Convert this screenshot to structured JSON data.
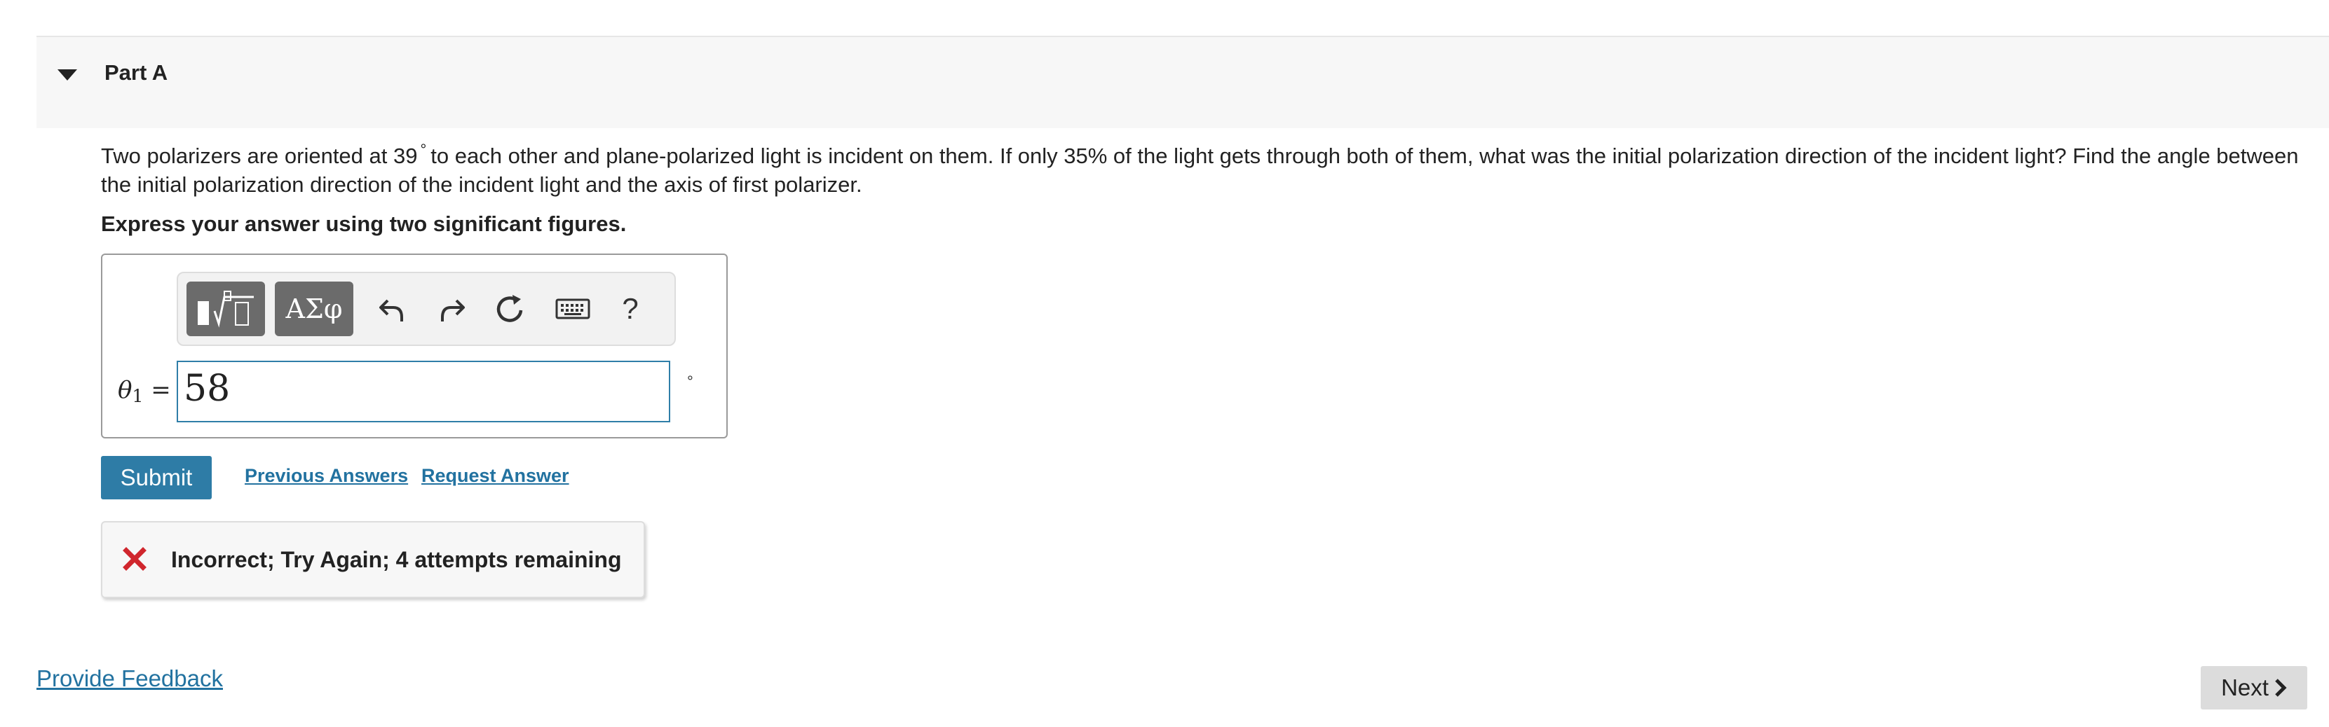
{
  "part": {
    "title": "Part A"
  },
  "question": {
    "text_before_deg": "Two polarizers are oriented at 39",
    "deg_symbol": "°",
    "text_after_deg": "to each other and plane-polarized light is incident on them. If only 35% of the light gets through both of them, what was the initial polarization direction of the incident light? Find the angle between the initial polarization direction of the incident light and the axis of first polarizer.",
    "instruction": "Express your answer using two significant figures."
  },
  "toolbar": {
    "templates_icon": "fraction-sqrt-templates-icon",
    "greek_label": "ΑΣφ",
    "undo_icon": "undo-icon",
    "redo_icon": "redo-icon",
    "reset_icon": "reset-icon",
    "keyboard_icon": "keyboard-icon",
    "help_label": "?"
  },
  "answer": {
    "var_symbol": "θ",
    "var_subscript": "1",
    "equals": "=",
    "value": "58",
    "unit": "°"
  },
  "actions": {
    "submit_label": "Submit",
    "previous_answers_label": "Previous Answers",
    "request_answer_label": "Request Answer"
  },
  "feedback": {
    "message": "Incorrect; Try Again; 4 attempts remaining",
    "icon": "x-icon",
    "icon_color": "#d0262d"
  },
  "footer": {
    "provide_feedback_label": "Provide Feedback",
    "next_label": "Next"
  },
  "colors": {
    "accent": "#2e7ca6",
    "link": "#2272a0",
    "toolbar_button": "#6b6b6b"
  }
}
